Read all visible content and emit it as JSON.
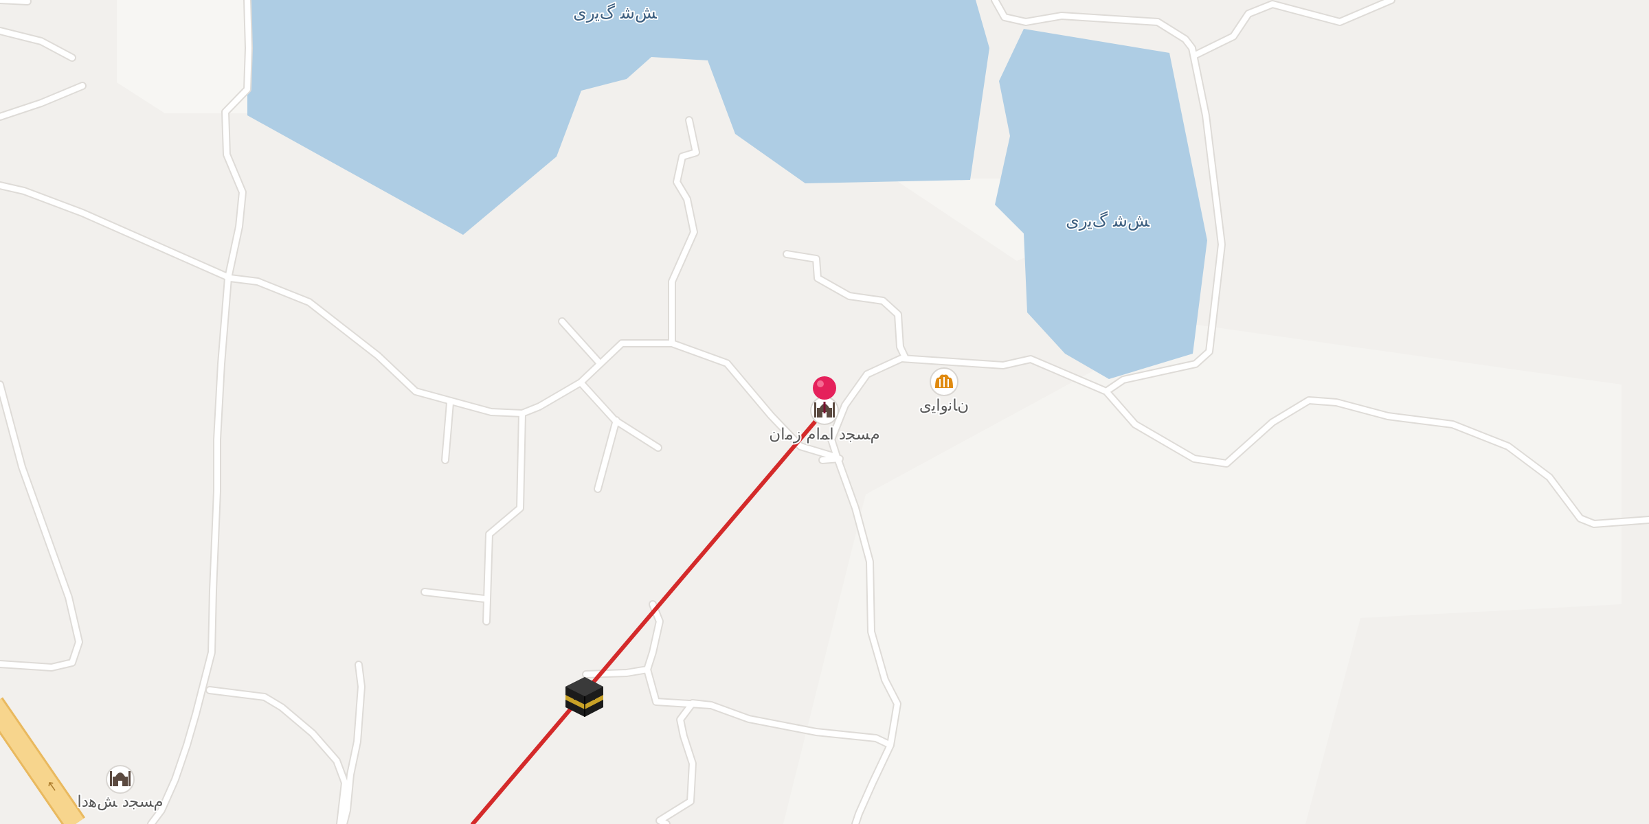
{
  "map": {
    "water_labels": [
      {
        "id": "lake-west",
        "text": "ﺶﺷ ﮒﯾﺭﯼ"
      },
      {
        "id": "lake-east",
        "text": "ﺶﺷ ﮒﯾﺭﯼ"
      }
    ],
    "places": [
      {
        "id": "mosque-imam-zaman",
        "label": "ﻡﺴﺠﺩ ﺍﻤﺍﻡ ﺯﻣﺍﻥ",
        "icon": "mosque-icon"
      },
      {
        "id": "bakery",
        "label": "ﻥﺎﻧﻭﺍﯾی",
        "icon": "bakery-icon"
      },
      {
        "id": "mosque-shohada",
        "label": "ﻡﺴﺠﺩ ﺶﻫﺩﺍ",
        "icon": "mosque-icon"
      }
    ],
    "markers": {
      "location_pin": {
        "icon": "location-pin-icon",
        "color": "#e5215b"
      },
      "qibla_target": {
        "icon": "kaaba-icon"
      }
    },
    "qibla_line": {
      "color": "#d42a2a"
    },
    "colors": {
      "background": "#f2f0ed",
      "water": "#aecde4",
      "road": "#ffffff",
      "highway": "#f7d58d",
      "poi_icon_mosque": "#5b4a40",
      "poi_icon_bakery": "#e08a10"
    }
  }
}
